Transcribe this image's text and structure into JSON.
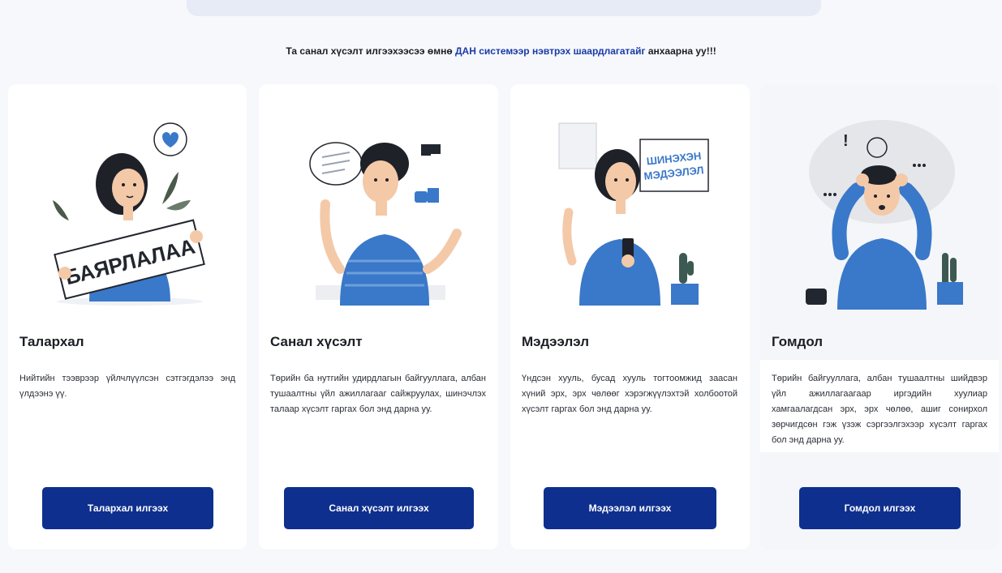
{
  "notice": {
    "before": "Та санал хүсэлт илгээхээсээ өмнө ",
    "link": "ДАН системээр нэвтрэх шаардлагатайг",
    "after": " анхаарна уу!!!"
  },
  "cards": [
    {
      "title": "Талархал",
      "description": "Нийтийн тээврээр үйлчлүүлсэн сэтгэгдэлээ энд үлдээнэ үү.",
      "illustration_text": "БАЯРЛАЛАА",
      "button": "Талархал илгээх"
    },
    {
      "title": "Санал хүсэлт",
      "description": "Төрийн ба нутгийн удирдлагын байгууллага, албан тушаалтны үйл ажиллагааг сайжруулах, шинэчлэх талаар хүсэлт гаргах бол энд дарна уу.",
      "button": "Санал хүсэлт илгээх"
    },
    {
      "title": "Мэдээлэл",
      "description": "Үндсэн хууль, бусад хууль тогтоомжид заасан хүний эрх, эрх чөлөөг хэрэгжүүлэхтэй холбоотой хүсэлт гаргах бол энд дарна уу.",
      "illustration_text_1": "ШИНЭХЭН",
      "illustration_text_2": "МЭДЭЭЛЭЛ",
      "button": "Мэдээлэл илгээх"
    },
    {
      "title": "Гомдол",
      "description": "Төрийн байгууллага, албан тушаалтны шийдвэр үйл ажиллагаагаар иргэдийн хуулиар хамгаалагдсан эрх, эрх чөлөө, ашиг сонирхол зөрчигдсөн гэж үзэж сэргээлгэхээр хүсэлт гаргах бол энд дарна уу.",
      "button": "Гомдол илгээх"
    }
  ],
  "colors": {
    "primary": "#0e2f8e",
    "accent_blue": "#3a78c9",
    "link": "#1a3aa8"
  }
}
